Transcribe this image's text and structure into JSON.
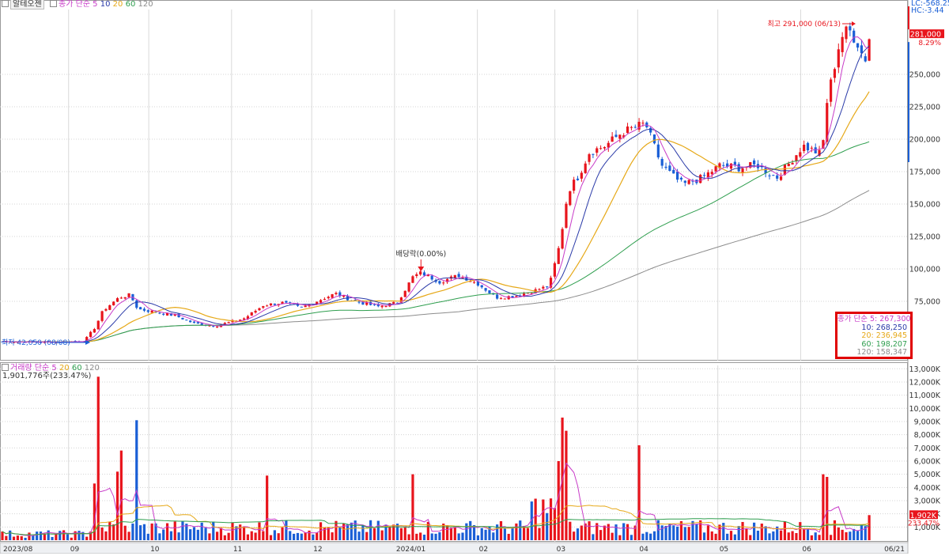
{
  "header": {
    "stock_name": "알테오젠",
    "ma_label": "종가 단순",
    "vol_label": "거래량 단순",
    "periods": [
      "5",
      "10",
      "20",
      "60",
      "120"
    ],
    "volume_info": "1,901,776주(233.47%)",
    "lc_label": "LC:-568.25",
    "hc_label": "HC:-3.44"
  },
  "annotations": {
    "high_label": "최고 291,000 (06/13)",
    "low_label": "최저 42,050 (08/08)",
    "dividend_label": "배당락(0.00%)"
  },
  "price_tag": {
    "value": "281,000",
    "change": "8.29%"
  },
  "volume_tag": {
    "value": "1,902K",
    "change": "233.47%"
  },
  "ma_legend": {
    "ma5": "종가 단순 5: 267,300",
    "ma10": "10: 268,250",
    "ma20": "20: 236,945",
    "ma60": "60: 198,207",
    "ma120": "120: 158,347"
  },
  "colors": {
    "up": "#e8141c",
    "down": "#1a5fd6",
    "ma5": "#c83cc8",
    "ma10": "#2a3aa8",
    "ma20": "#e6a817",
    "ma60": "#2e9e4e",
    "ma120": "#8c8c8c",
    "highlight": "#e00000"
  },
  "chart_data": [
    {
      "type": "candlestick",
      "title": "알테오젠",
      "y_ticks": [
        "100,000",
        "125,000",
        "150,000",
        "175,000",
        "200,000",
        "225,000",
        "250,000",
        "75,000"
      ],
      "ylim": [
        40000,
        300000
      ],
      "x_ticks": [
        "2023/08",
        "09",
        "10",
        "11",
        "12",
        "2024/01",
        "02",
        "03",
        "04",
        "05",
        "06",
        "06/21"
      ],
      "x_range": [
        "2023/08/01",
        "2024/06/21"
      ],
      "last_close": 281000,
      "high": 291000,
      "high_date": "06/13",
      "low": 42050,
      "low_date": "08/08",
      "close_path": [
        [
          "2023/08/01",
          44000
        ],
        [
          "2023/08/20",
          43500
        ],
        [
          "2023/09/01",
          44500
        ],
        [
          "2023/09/05",
          55000
        ],
        [
          "2023/09/08",
          68000
        ],
        [
          "2023/09/14",
          78000
        ],
        [
          "2023/09/18",
          80000
        ],
        [
          "2023/09/21",
          69000
        ],
        [
          "2023/09/27",
          67000
        ],
        [
          "2023/10/05",
          64000
        ],
        [
          "2023/10/12",
          58000
        ],
        [
          "2023/10/20",
          56000
        ],
        [
          "2023/10/31",
          62000
        ],
        [
          "2023/11/07",
          72000
        ],
        [
          "2023/11/14",
          74000
        ],
        [
          "2023/11/21",
          70000
        ],
        [
          "2023/11/28",
          76000
        ],
        [
          "2023/12/04",
          81000
        ],
        [
          "2023/12/11",
          75000
        ],
        [
          "2023/12/20",
          71000
        ],
        [
          "2023/12/27",
          74000
        ],
        [
          "2024/01/02",
          94000
        ],
        [
          "2024/01/05",
          97000
        ],
        [
          "2024/01/12",
          90000
        ],
        [
          "2024/01/19",
          95000
        ],
        [
          "2024/01/26",
          89000
        ],
        [
          "2024/02/02",
          78000
        ],
        [
          "2024/02/09",
          79000
        ],
        [
          "2024/02/16",
          83000
        ],
        [
          "2024/02/22",
          87000
        ],
        [
          "2024/02/26",
          120000
        ],
        [
          "2024/02/29",
          160000
        ],
        [
          "2024/03/04",
          172000
        ],
        [
          "2024/03/08",
          190000
        ],
        [
          "2024/03/14",
          195000
        ],
        [
          "2024/03/20",
          205000
        ],
        [
          "2024/03/26",
          210000
        ],
        [
          "2024/03/29",
          212000
        ],
        [
          "2024/04/04",
          180000
        ],
        [
          "2024/04/08",
          172000
        ],
        [
          "2024/04/12",
          165000
        ],
        [
          "2024/04/19",
          170000
        ],
        [
          "2024/04/26",
          180000
        ],
        [
          "2024/05/03",
          178000
        ],
        [
          "2024/05/10",
          180000
        ],
        [
          "2024/05/17",
          170000
        ],
        [
          "2024/05/22",
          182000
        ],
        [
          "2024/05/27",
          195000
        ],
        [
          "2024/06/03",
          188000
        ],
        [
          "2024/06/05",
          230000
        ],
        [
          "2024/06/10",
          278000
        ],
        [
          "2024/06/13",
          285000
        ],
        [
          "2024/06/17",
          272000
        ],
        [
          "2024/06/19",
          259000
        ],
        [
          "2024/06/21",
          281000
        ]
      ],
      "series": [
        {
          "name": "5",
          "values": [
            [
              "2024/06/21",
              267300
            ]
          ]
        },
        {
          "name": "10",
          "values": [
            [
              "2024/06/21",
              268250
            ]
          ]
        },
        {
          "name": "20",
          "values": [
            [
              "2024/06/21",
              236945
            ]
          ]
        },
        {
          "name": "60",
          "values": [
            [
              "2024/06/21",
              198207
            ]
          ]
        },
        {
          "name": "120",
          "values": [
            [
              "2024/06/21",
              158347
            ]
          ]
        }
      ]
    },
    {
      "type": "bar",
      "title": "거래량",
      "y_ticks": [
        "1,000K",
        "2,000K",
        "3,000K",
        "4,000K",
        "5,000K",
        "6,000K",
        "7,000K",
        "8,000K",
        "9,000K",
        "10,000K",
        "11,000K",
        "12,000K",
        "13,000K"
      ],
      "ylim": [
        0,
        13500
      ],
      "unit": "K",
      "spikes": [
        [
          "2023/09/05",
          4300
        ],
        [
          "2023/09/06",
          12400
        ],
        [
          "2023/09/13",
          5200
        ],
        [
          "2023/09/15",
          6800
        ],
        [
          "2023/09/21",
          9100
        ],
        [
          "2023/11/09",
          4900
        ],
        [
          "2024/01/02",
          5000
        ],
        [
          "2024/02/26",
          6000
        ],
        [
          "2024/02/27",
          9300
        ],
        [
          "2024/02/28",
          8300
        ],
        [
          "2024/03/26",
          7200
        ],
        [
          "2024/06/03",
          5000
        ],
        [
          "2024/06/05",
          4800
        ],
        [
          "2024/06/21",
          1902
        ]
      ],
      "last_volume": 1902
    }
  ]
}
